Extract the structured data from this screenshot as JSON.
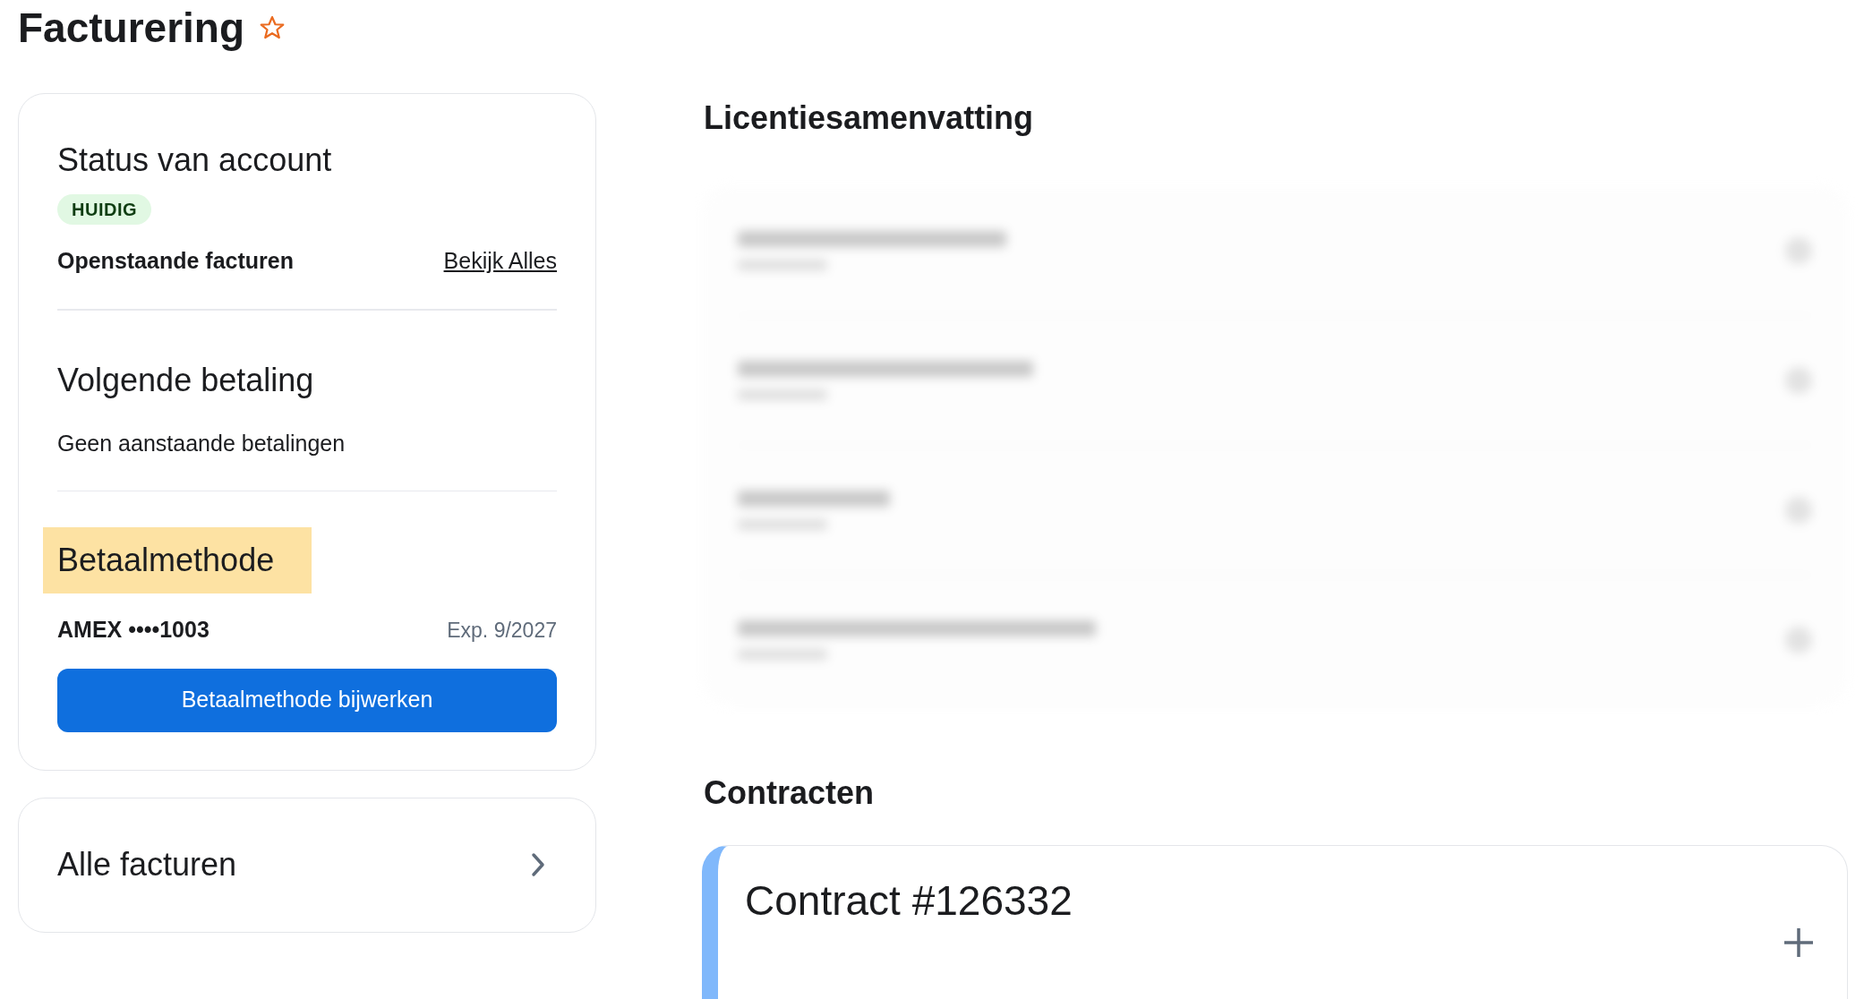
{
  "page": {
    "title": "Facturering",
    "starred": false
  },
  "account_card": {
    "status": {
      "heading": "Status van account",
      "badge": "HUIDIG",
      "open_invoices_label": "Openstaande facturen",
      "view_all_link": "Bekijk Alles"
    },
    "next_payment": {
      "heading": "Volgende betaling",
      "text": "Geen aanstaande betalingen"
    },
    "payment_method": {
      "heading": "Betaalmethode",
      "highlighted": true,
      "card": "AMEX ••••1003",
      "expiry": "Exp. 9/2027",
      "button": "Betaalmethode bijwerken"
    }
  },
  "all_invoices": {
    "label": "Alle facturen"
  },
  "license_summary": {
    "heading": "Licentiesamenvatting"
  },
  "contracts": {
    "heading": "Contracten",
    "items": [
      {
        "title": "Contract #126332",
        "expanded": false
      }
    ]
  }
}
